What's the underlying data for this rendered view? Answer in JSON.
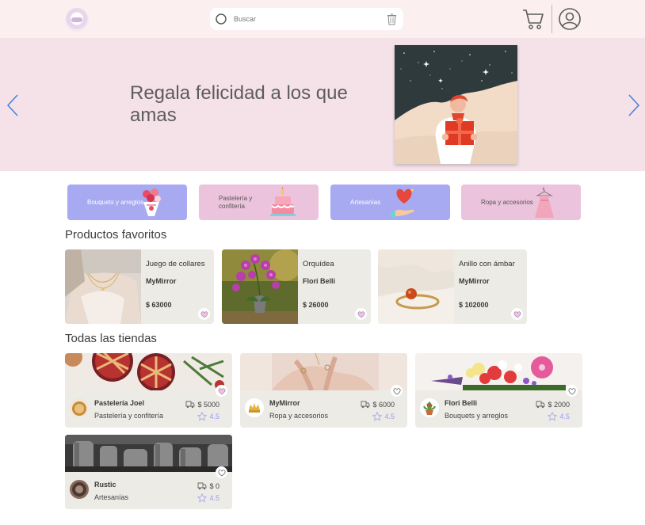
{
  "search": {
    "placeholder": "Buscar"
  },
  "hero": {
    "title": "Regala felicidad a los que amas"
  },
  "categories": [
    {
      "label": "Bouquets y arreglos",
      "bg": "#a7a9f1",
      "color": "#ffffff"
    },
    {
      "label": "Pastelería y confitería",
      "bg": "#ecc3dc",
      "color": "#555555"
    },
    {
      "label": "Artesanías",
      "bg": "#a7a9f1",
      "color": "#ffffff"
    },
    {
      "label": "Ropa y accesorios",
      "bg": "#ecc3dc",
      "color": "#555555"
    }
  ],
  "favorites": {
    "title": "Productos favoritos",
    "items": [
      {
        "name": "Juego de collares",
        "store": "MyMirror",
        "price": "$ 63000"
      },
      {
        "name": "Orquídea",
        "store": "Flori Belli",
        "price": "$ 26000"
      },
      {
        "name": "Anillo con ámbar",
        "store": "MyMirror",
        "price": "$ 102000"
      }
    ]
  },
  "stores": {
    "title": "Todas las tiendas",
    "items": [
      {
        "name": "Pastelería Joel",
        "category": "Pastelería y confitería",
        "shipping": "$ 5000",
        "rating": "4.5"
      },
      {
        "name": "MyMirror",
        "category": "Ropa y accesorios",
        "shipping": "$ 6000",
        "rating": "4.5"
      },
      {
        "name": "Flori Belli",
        "category": "Bouquets y arreglos",
        "shipping": "$ 2000",
        "rating": "4.5"
      },
      {
        "name": "Rustic",
        "category": "Artesanías",
        "shipping": "$ 0",
        "rating": "4.5"
      }
    ]
  },
  "colors": {
    "header": "#fbefef",
    "hero": "#f5e1e8",
    "accent": "#4a7fd6",
    "lilac": "#a7a9f1",
    "pink": "#ecc3dc"
  }
}
